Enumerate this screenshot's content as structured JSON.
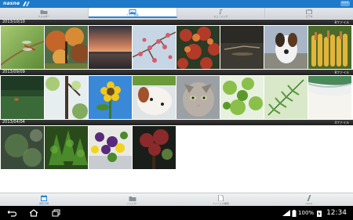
{
  "app": {
    "logo": "nasne"
  },
  "titlebar": {
    "menu_label": "•••"
  },
  "tabs": [
    {
      "label": "フォルダー",
      "active": false
    },
    {
      "label": "フォト/動画",
      "active": true
    },
    {
      "label": "ミュージック",
      "active": false
    },
    {
      "label": "ビデオ",
      "active": false
    }
  ],
  "groups": [
    {
      "date": "2013/10/10",
      "count": "8ファイル"
    },
    {
      "date": "2013/09/09",
      "count": "8ファイル"
    },
    {
      "date": "2013/04/04",
      "count": "4ファイル"
    }
  ],
  "bottom_nav": [
    {
      "label": "撮影日時",
      "active": true
    },
    {
      "label": "フォルダー",
      "active": false
    },
    {
      "label": "ファイルの種類",
      "active": false
    },
    {
      "label": "nasne",
      "active": false
    }
  ],
  "status": {
    "battery": "100%",
    "time": "12:34"
  },
  "colors": {
    "brand": "#1e79c8",
    "accent": "#2a86d6",
    "header": "#2a2a2a"
  }
}
